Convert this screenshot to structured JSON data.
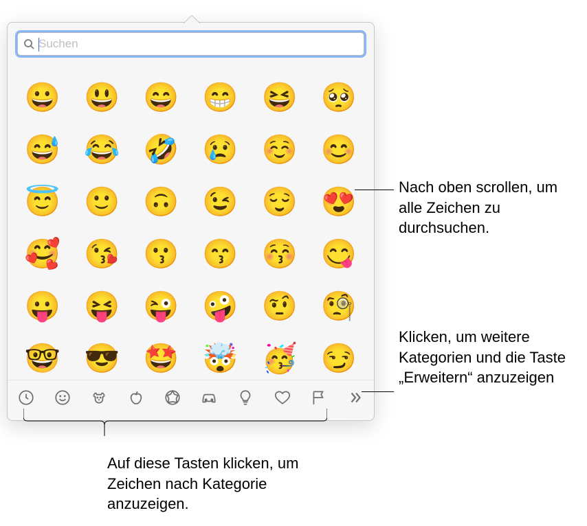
{
  "search": {
    "placeholder": "Suchen"
  },
  "emojis": [
    "😀",
    "😃",
    "😄",
    "😁",
    "😆",
    "🥺",
    "😅",
    "😂",
    "🤣",
    "😢",
    "☺️",
    "😊",
    "😇",
    "🙂",
    "🙃",
    "😉",
    "😌",
    "😍",
    "🥰",
    "😘",
    "😗",
    "😙",
    "😚",
    "😋",
    "😛",
    "😝",
    "😜",
    "🤪",
    "🤨",
    "🧐",
    "🤓",
    "😎",
    "🤩",
    "🤯",
    "🥳",
    "😏"
  ],
  "categories": [
    {
      "name": "recent",
      "icon": "clock"
    },
    {
      "name": "smileys",
      "icon": "smiley"
    },
    {
      "name": "animals",
      "icon": "dog"
    },
    {
      "name": "food",
      "icon": "apple"
    },
    {
      "name": "activity",
      "icon": "soccer"
    },
    {
      "name": "travel",
      "icon": "car"
    },
    {
      "name": "objects",
      "icon": "bulb"
    },
    {
      "name": "symbols",
      "icon": "heart"
    },
    {
      "name": "flags",
      "icon": "flag"
    },
    {
      "name": "more",
      "icon": "chevrons"
    }
  ],
  "callouts": {
    "scroll": "Nach oben scrollen, um alle Zeichen zu durchsuchen.",
    "expand": "Klicken, um weitere Kategorien und die Taste „Erweitern“ anzuzeigen",
    "categories": "Auf diese Tasten klicken, um Zeichen nach Kategorie anzuzeigen."
  }
}
